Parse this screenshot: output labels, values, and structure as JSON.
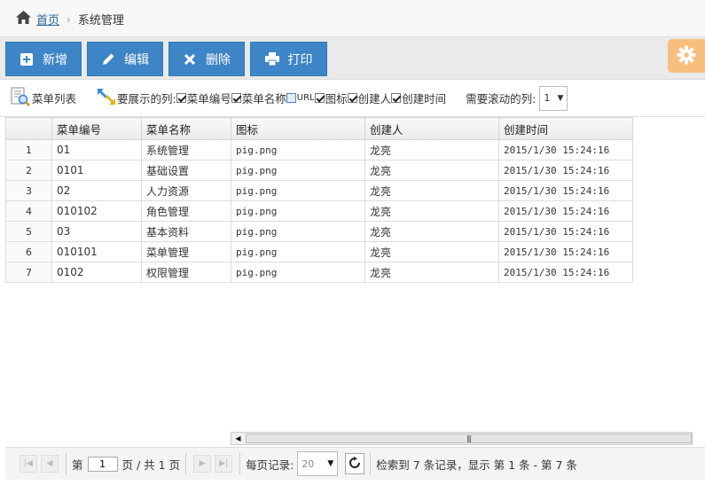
{
  "breadcrumb": {
    "home": "首页",
    "current": "系统管理"
  },
  "toolbar": {
    "buttons": [
      {
        "label": "新增",
        "icon": "plus-icon"
      },
      {
        "label": "编辑",
        "icon": "pencil-icon"
      },
      {
        "label": "删除",
        "icon": "close-icon"
      },
      {
        "label": "打印",
        "icon": "print-icon"
      }
    ],
    "accent": "#3d85c6",
    "settings_icon": "gear-icon",
    "settings_color": "#f7be7e"
  },
  "filterbar": {
    "list_title": "菜单列表",
    "columns_label": "要展示的列:",
    "columns": [
      {
        "label": "菜单编号",
        "checked": true
      },
      {
        "label": "菜单名称",
        "checked": true
      },
      {
        "label": "URL",
        "checked": false
      },
      {
        "label": "图标",
        "checked": true
      },
      {
        "label": "创建人",
        "checked": true
      },
      {
        "label": "创建时间",
        "checked": true
      }
    ],
    "scroll_label": "需要滚动的列:",
    "scroll_value": "1"
  },
  "grid": {
    "headers": [
      "菜单编号",
      "菜单名称",
      "图标",
      "创建人",
      "创建时间"
    ],
    "rows": [
      {
        "no": "1",
        "code": "01",
        "name": "系统管理",
        "icon": "pig.png",
        "creator": "龙亮",
        "time": "2015/1/30 15:24:16"
      },
      {
        "no": "2",
        "code": "0101",
        "name": "基础设置",
        "icon": "pig.png",
        "creator": "龙亮",
        "time": "2015/1/30 15:24:16"
      },
      {
        "no": "3",
        "code": "02",
        "name": "人力资源",
        "icon": "pig.png",
        "creator": "龙亮",
        "time": "2015/1/30 15:24:16"
      },
      {
        "no": "4",
        "code": "010102",
        "name": "角色管理",
        "icon": "pig.png",
        "creator": "龙亮",
        "time": "2015/1/30 15:24:16"
      },
      {
        "no": "5",
        "code": "03",
        "name": "基本资料",
        "icon": "pig.png",
        "creator": "龙亮",
        "time": "2015/1/30 15:24:16"
      },
      {
        "no": "6",
        "code": "010101",
        "name": "菜单管理",
        "icon": "pig.png",
        "creator": "龙亮",
        "time": "2015/1/30 15:24:16"
      },
      {
        "no": "7",
        "code": "0102",
        "name": "权限管理",
        "icon": "pig.png",
        "creator": "龙亮",
        "time": "2015/1/30 15:24:16"
      }
    ]
  },
  "pager": {
    "page_prefix": "第",
    "page_value": "1",
    "page_suffix": "页 / 共 1 页",
    "per_page_label": "每页记录:",
    "per_page_value": "20",
    "summary": "检索到 7 条记录，显示 第 1 条 - 第 7 条"
  }
}
